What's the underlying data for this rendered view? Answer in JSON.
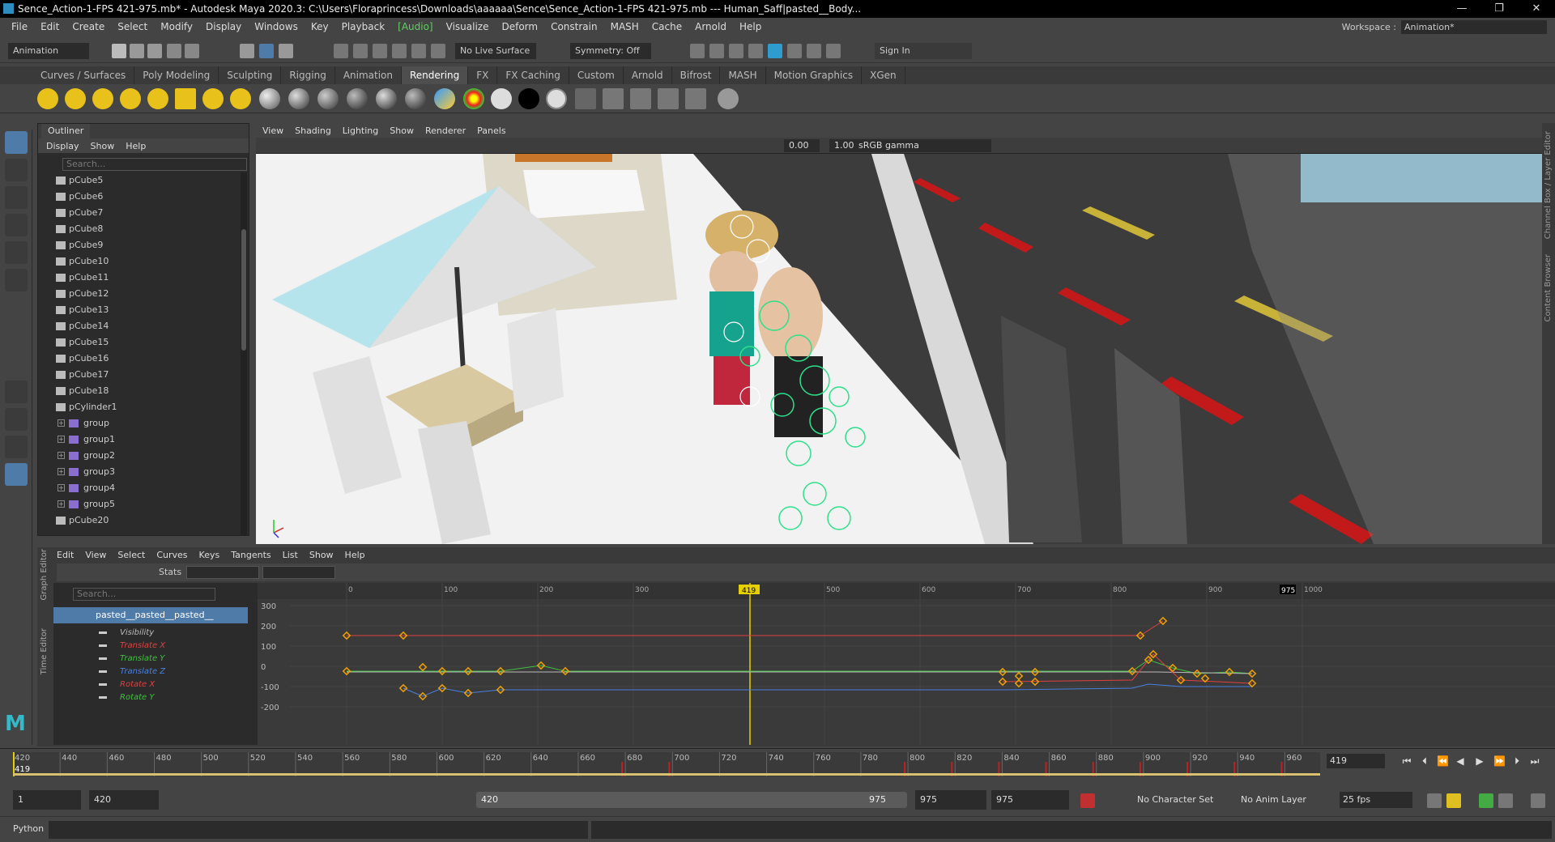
{
  "window": {
    "title": "Sence_Action-1-FPS 421-975.mb* - Autodesk Maya 2020.3: C:\\Users\\Floraprincess\\Downloads\\aaaaaa\\Sence\\Sence_Action-1-FPS 421-975.mb   ---   Human_Saff|pasted__Body...",
    "min": "—",
    "max": "❐",
    "close": "✕"
  },
  "menubar": [
    "File",
    "Edit",
    "Create",
    "Select",
    "Modify",
    "Display",
    "Windows",
    "Key",
    "Playback",
    "[Audio]",
    "Visualize",
    "Deform",
    "Constrain",
    "MASH",
    "Cache",
    "Arnold",
    "Help"
  ],
  "workspace": {
    "label": "Workspace :",
    "value": "Animation*"
  },
  "statusline": {
    "mode": "Animation",
    "live_surface": "No Live Surface",
    "symmetry": "Symmetry: Off",
    "sign_in": "Sign In"
  },
  "shelf_tabs": [
    "Curves / Surfaces",
    "Poly Modeling",
    "Sculpting",
    "Rigging",
    "Animation",
    "Rendering",
    "FX",
    "FX Caching",
    "Custom",
    "Arnold",
    "Bifrost",
    "MASH",
    "Motion Graphics",
    "XGen"
  ],
  "shelf_active": "Rendering",
  "outliner": {
    "tab": "Outliner",
    "menu": [
      "Display",
      "Show",
      "Help"
    ],
    "search_placeholder": "Search...",
    "items": [
      {
        "label": "pCube5",
        "type": "mesh"
      },
      {
        "label": "pCube6",
        "type": "mesh"
      },
      {
        "label": "pCube7",
        "type": "mesh"
      },
      {
        "label": "pCube8",
        "type": "mesh"
      },
      {
        "label": "pCube9",
        "type": "mesh"
      },
      {
        "label": "pCube10",
        "type": "mesh"
      },
      {
        "label": "pCube11",
        "type": "mesh"
      },
      {
        "label": "pCube12",
        "type": "mesh"
      },
      {
        "label": "pCube13",
        "type": "mesh"
      },
      {
        "label": "pCube14",
        "type": "mesh"
      },
      {
        "label": "pCube15",
        "type": "mesh"
      },
      {
        "label": "pCube16",
        "type": "mesh"
      },
      {
        "label": "pCube17",
        "type": "mesh"
      },
      {
        "label": "pCube18",
        "type": "mesh"
      },
      {
        "label": "pCylinder1",
        "type": "mesh"
      },
      {
        "label": "group",
        "type": "group"
      },
      {
        "label": "group1",
        "type": "group"
      },
      {
        "label": "group2",
        "type": "group"
      },
      {
        "label": "group3",
        "type": "group"
      },
      {
        "label": "group4",
        "type": "group"
      },
      {
        "label": "group5",
        "type": "group"
      },
      {
        "label": "pCube20",
        "type": "mesh"
      }
    ]
  },
  "viewport": {
    "menu": [
      "View",
      "Shading",
      "Lighting",
      "Show",
      "Renderer",
      "Panels"
    ],
    "exposure": "0.00",
    "gamma": "1.00",
    "colorspace": "sRGB gamma"
  },
  "right_strip": [
    "Channel Box / Layer Editor",
    "Content Browser"
  ],
  "graph_editor": {
    "side_tabs": [
      "Graph Editor",
      "Time Editor"
    ],
    "menu": [
      "Edit",
      "View",
      "Select",
      "Curves",
      "Keys",
      "Tangents",
      "List",
      "Show",
      "Help"
    ],
    "stats_label": "Stats",
    "search_placeholder": "Search...",
    "root_node": "pasted__pasted__pasted__",
    "channels": [
      {
        "label": "Visibility",
        "color": "#bbbbbb"
      },
      {
        "label": "Translate X",
        "color": "#e04040"
      },
      {
        "label": "Translate Y",
        "color": "#40c040"
      },
      {
        "label": "Translate Z",
        "color": "#4a80e0"
      },
      {
        "label": "Rotate X",
        "color": "#e04040"
      },
      {
        "label": "Rotate Y",
        "color": "#40c040"
      }
    ],
    "x_ticks": [
      "0",
      "100",
      "200",
      "300",
      "500",
      "600",
      "700",
      "800",
      "900",
      "1000"
    ],
    "y_ticks": [
      "300",
      "200",
      "100",
      "0",
      "-100",
      "-200"
    ],
    "current_frame_marker": "419",
    "end_marker": "975"
  },
  "timeline": {
    "ticks": [
      "420",
      "440",
      "460",
      "480",
      "500",
      "520",
      "540",
      "560",
      "580",
      "600",
      "620",
      "640",
      "660",
      "680",
      "700",
      "720",
      "740",
      "760",
      "780",
      "800",
      "820",
      "840",
      "860",
      "880",
      "900",
      "920",
      "940",
      "960"
    ],
    "current": "419",
    "frame_field": "419"
  },
  "range": {
    "start": "1",
    "anim_start": "420",
    "slider_start": "420",
    "slider_end": "975",
    "anim_end": "975",
    "end": "975",
    "character_set": "No Character Set",
    "anim_layer": "No Anim Layer",
    "fps": "25 fps"
  },
  "command": {
    "label": "Python"
  }
}
